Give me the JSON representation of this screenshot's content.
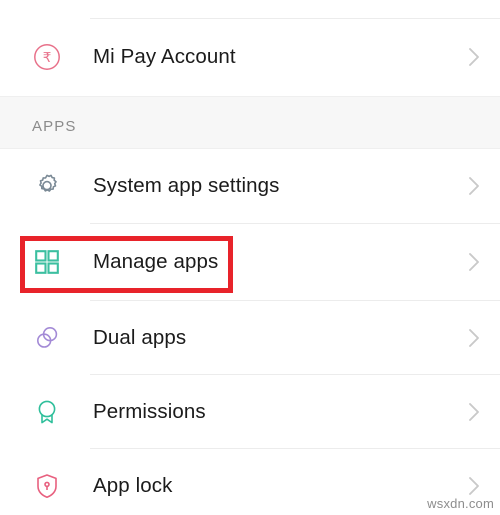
{
  "screen": {
    "background_color": "#ffffff",
    "text_color": "#1b1b1b",
    "divider_color": "#ececec",
    "section_band_color": "#f7f7f7",
    "chevron_color": "#c9c9c9",
    "highlight_color": "#e8232a"
  },
  "top_row": {
    "label": "Mi Pay Account",
    "icon": "rupee-circle-icon",
    "icon_color": "#e8718a",
    "chevron": "chevron-right-icon"
  },
  "section": {
    "title": "APPS"
  },
  "items": [
    {
      "label": "System app settings",
      "icon": "gear-icon",
      "icon_color": "#7b8a96",
      "chevron": "chevron-right-icon",
      "highlighted": false
    },
    {
      "label": "Manage apps",
      "icon": "grid-apps-icon",
      "icon_color": "#3cbfa0",
      "chevron": "chevron-right-icon",
      "highlighted": true
    },
    {
      "label": "Dual apps",
      "icon": "dual-circles-icon",
      "icon_color": "#a38ad6",
      "chevron": "chevron-right-icon",
      "highlighted": false
    },
    {
      "label": "Permissions",
      "icon": "badge-ribbon-icon",
      "icon_color": "#2fbf9b",
      "chevron": "chevron-right-icon",
      "highlighted": false
    },
    {
      "label": "App lock",
      "icon": "shield-lock-icon",
      "icon_color": "#e8607f",
      "chevron": "chevron-right-icon",
      "highlighted": false
    }
  ],
  "watermark": {
    "text": "wsxdn.com"
  }
}
